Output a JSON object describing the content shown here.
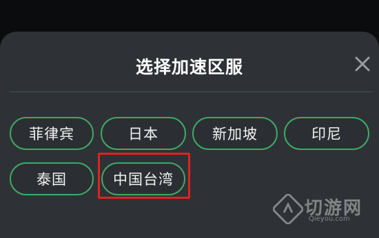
{
  "dialog": {
    "title": "选择加速区服"
  },
  "servers": {
    "row1": [
      {
        "label": "菲律宾"
      },
      {
        "label": "日本"
      },
      {
        "label": "新加坡"
      },
      {
        "label": "印尼"
      }
    ],
    "row2": [
      {
        "label": "泰国"
      },
      {
        "label": "中国台湾"
      }
    ],
    "highlighted": "中国台湾"
  },
  "watermark": {
    "brand": "切游网",
    "domain": "Qieyou.com"
  },
  "colors": {
    "sheet_bg": "#2e3236",
    "button_border": "#3faa66",
    "highlight_box": "#e0231c",
    "text": "#ffffff"
  },
  "icons": {
    "close": "close-icon",
    "watermark_logo": "watermark-logo-icon"
  }
}
